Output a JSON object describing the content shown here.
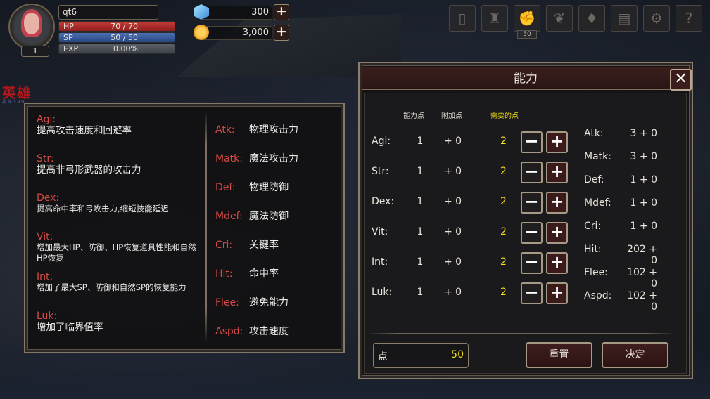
{
  "player": {
    "name": "qt6",
    "level": "1",
    "hp_label": "HP",
    "hp_value": "70 / 70",
    "hp_fill": 1.0,
    "sp_label": "SP",
    "sp_value": "50 / 50",
    "sp_fill": 1.0,
    "exp_label": "EXP",
    "exp_value": "0.00%",
    "exp_fill": 0.0
  },
  "currency": {
    "gems": "300",
    "gold": "3,000",
    "plus": "+"
  },
  "top_icons": [
    {
      "name": "card-icon",
      "glyph": "▯"
    },
    {
      "name": "helmet-icon",
      "glyph": "♜"
    },
    {
      "name": "fist-icon",
      "glyph": "✊"
    },
    {
      "name": "wings-icon",
      "glyph": "❦"
    },
    {
      "name": "bag-icon",
      "glyph": "♦"
    },
    {
      "name": "book-icon",
      "glyph": "▤"
    },
    {
      "name": "gear-icon",
      "glyph": "⚙"
    },
    {
      "name": "help-icon",
      "glyph": "?"
    }
  ],
  "fist_badge": "50",
  "hero_title": "英雄",
  "hero_subtitle": "英 雄 1 9 9",
  "descriptions": [
    {
      "name": "Agi:",
      "text": "提高攻击速度和回避率",
      "small": false
    },
    {
      "name": "Str:",
      "text": "提高非弓形武器的攻击力",
      "small": false
    },
    {
      "name": "Dex:",
      "text": "提高命中率和弓攻击力,缩短技能延迟",
      "small": true
    },
    {
      "name": "Vit:",
      "text": "增加最大HP、防御、HP恢复道具性能和自然HP恢复",
      "small": true
    },
    {
      "name": "Int:",
      "text": "增加了最大SP、防御和自然SP的恢复能力",
      "small": true
    },
    {
      "name": "Luk:",
      "text": "增加了临界值率",
      "small": false
    }
  ],
  "stat_descriptions": [
    {
      "name": "Atk:",
      "text": "物理攻击力"
    },
    {
      "name": "Matk:",
      "text": "魔法攻击力"
    },
    {
      "name": "Def:",
      "text": "物理防御"
    },
    {
      "name": "Mdef:",
      "text": "魔法防御"
    },
    {
      "name": "Cri:",
      "text": "关键率"
    },
    {
      "name": "Hit:",
      "text": "命中率"
    },
    {
      "name": "Flee:",
      "text": "避免能力"
    },
    {
      "name": "Aspd:",
      "text": "攻击速度"
    }
  ],
  "ability": {
    "title": "能力",
    "close": "✕",
    "col_points": "能力点",
    "col_bonus": "附加点",
    "col_required": "需要的点",
    "rows": [
      {
        "name": "Agi:",
        "points": "1",
        "bonus": "+ 0",
        "required": "2"
      },
      {
        "name": "Str:",
        "points": "1",
        "bonus": "+ 0",
        "required": "2"
      },
      {
        "name": "Dex:",
        "points": "1",
        "bonus": "+ 0",
        "required": "2"
      },
      {
        "name": "Vit:",
        "points": "1",
        "bonus": "+ 0",
        "required": "2"
      },
      {
        "name": "Int:",
        "points": "1",
        "bonus": "+ 0",
        "required": "2"
      },
      {
        "name": "Luk:",
        "points": "1",
        "bonus": "+ 0",
        "required": "2"
      }
    ],
    "minus": "−",
    "plus": "+",
    "results": [
      {
        "name": "Atk:",
        "value": "3 + 0"
      },
      {
        "name": "Matk:",
        "value": "3 + 0"
      },
      {
        "name": "Def:",
        "value": "1 + 0"
      },
      {
        "name": "Mdef:",
        "value": "1 + 0"
      },
      {
        "name": "Cri:",
        "value": "1 + 0"
      },
      {
        "name": "Hit:",
        "value": "202 + 0"
      },
      {
        "name": "Flee:",
        "value": "102 + 0"
      },
      {
        "name": "Aspd:",
        "value": "102 + 0"
      }
    ],
    "points_label": "点",
    "points_value": "50",
    "reset_label": "重置",
    "confirm_label": "决定"
  }
}
